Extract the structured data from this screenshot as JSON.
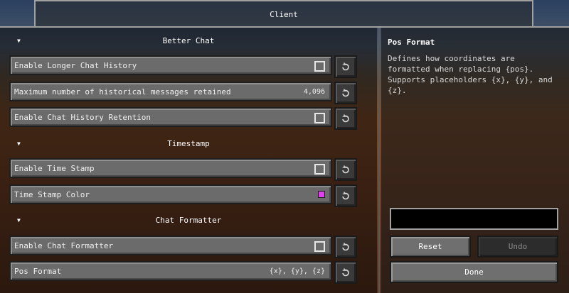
{
  "tab": {
    "label": "Client"
  },
  "sections": {
    "better_chat": "Better Chat",
    "timestamp": "Timestamp",
    "chat_formatter": "Chat Formatter"
  },
  "options": [
    {
      "label": "Enable Longer Chat History",
      "type": "checkbox",
      "checked": false
    },
    {
      "label": "Maximum number of historical messages retained",
      "type": "number",
      "value": "4,096"
    },
    {
      "label": "Enable Chat History Retention",
      "type": "checkbox",
      "checked": false
    },
    {
      "label": "Enable Time Stamp",
      "type": "checkbox",
      "checked": false
    },
    {
      "label": "Time Stamp Color",
      "type": "color",
      "color": "#e040f0"
    },
    {
      "label": "Enable Chat Formatter",
      "type": "checkbox",
      "checked": false
    },
    {
      "label": "Pos Format",
      "type": "text",
      "value": "{x}, {y}, {z}"
    }
  ],
  "panel": {
    "title": "Pos Format",
    "description": "Defines how coordinates are formatted when replacing {pos}. Supports placeholders {x}, {y}, and {z}.",
    "input_value": ""
  },
  "buttons": {
    "reset": "Reset",
    "undo": "Undo",
    "done": "Done"
  },
  "icons": {
    "section_toggle": "triangle-down-icon",
    "reset": "reset-arrow-icon"
  },
  "colors": {
    "time_stamp_swatch": "#e040f0"
  }
}
